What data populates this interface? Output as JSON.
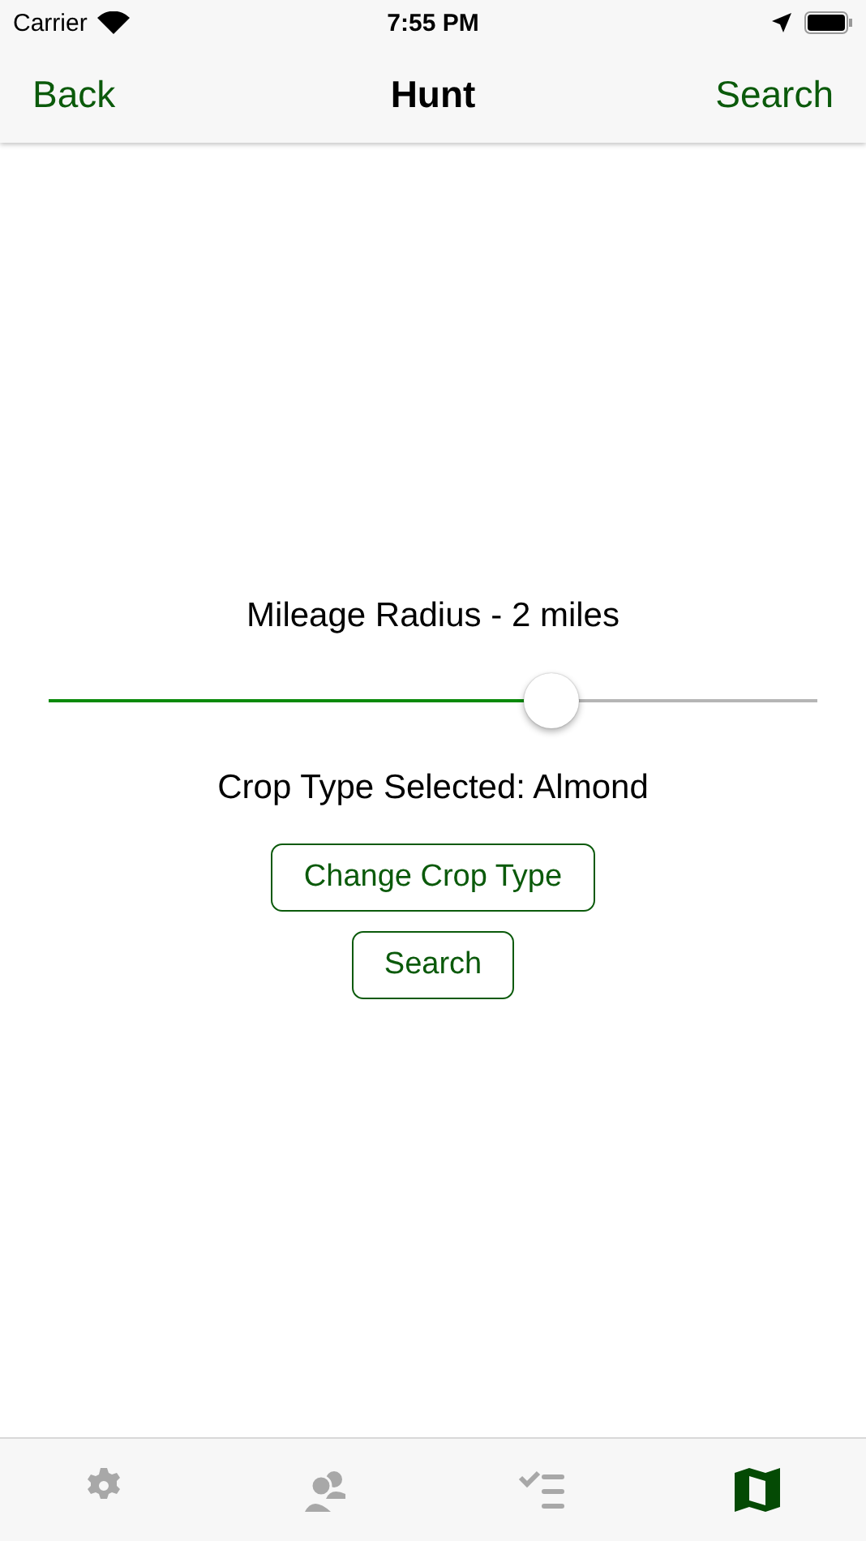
{
  "status_bar": {
    "carrier": "Carrier",
    "time": "7:55 PM"
  },
  "nav": {
    "back": "Back",
    "title": "Hunt",
    "action": "Search"
  },
  "radius": {
    "label": "Mileage Radius - 2 miles",
    "level": 0.654
  },
  "crop_label": "Crop Type Selected: Almond",
  "buttons": [
    "Change Crop Type",
    "Search"
  ],
  "tabs": [
    {
      "kind": "settings",
      "selected": false
    },
    {
      "kind": "people",
      "selected": false
    },
    {
      "kind": "tasks",
      "selected": false
    },
    {
      "kind": "map",
      "selected": true
    }
  ]
}
